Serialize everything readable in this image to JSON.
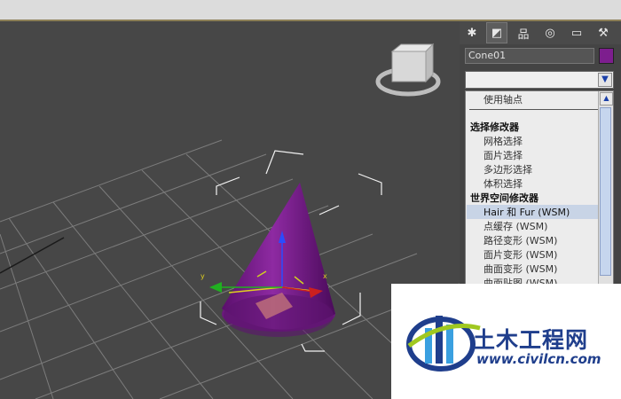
{
  "command_panel": {
    "tabs": [
      {
        "icon": "create-icon",
        "glyph": "✱"
      },
      {
        "icon": "modify-icon",
        "glyph": "◩"
      },
      {
        "icon": "hierarchy-icon",
        "glyph": "品"
      },
      {
        "icon": "motion-icon",
        "glyph": "◎"
      },
      {
        "icon": "display-icon",
        "glyph": "▭"
      },
      {
        "icon": "utilities-icon",
        "glyph": "⚒"
      }
    ],
    "object_name": "Cone01",
    "object_color": "#7d1e8e",
    "modifier_list": {
      "dropdown_value": "",
      "items": [
        {
          "type": "item",
          "label": "使用轴点"
        },
        {
          "type": "separator"
        },
        {
          "type": "header",
          "label": "选择修改器"
        },
        {
          "type": "item",
          "label": "网格选择"
        },
        {
          "type": "item",
          "label": "面片选择"
        },
        {
          "type": "item",
          "label": "多边形选择"
        },
        {
          "type": "item",
          "label": "体积选择"
        },
        {
          "type": "header",
          "label": "世界空间修改器"
        },
        {
          "type": "item",
          "label": "Hair 和 Fur (WSM)",
          "selected": true
        },
        {
          "type": "item",
          "label": "点缓存 (WSM)"
        },
        {
          "type": "item",
          "label": "路径变形 (WSM)"
        },
        {
          "type": "item",
          "label": "面片变形 (WSM)"
        },
        {
          "type": "item",
          "label": "曲面变形 (WSM)"
        },
        {
          "type": "item",
          "label": "曲面贴图 (WSM)"
        }
      ]
    }
  },
  "viewport": {
    "object_color": "#7a1c8c",
    "gizmo_axes": {
      "x": "x",
      "y": "y"
    }
  },
  "watermark": {
    "title": "土木工程网",
    "url": "www.civilcn.com"
  }
}
